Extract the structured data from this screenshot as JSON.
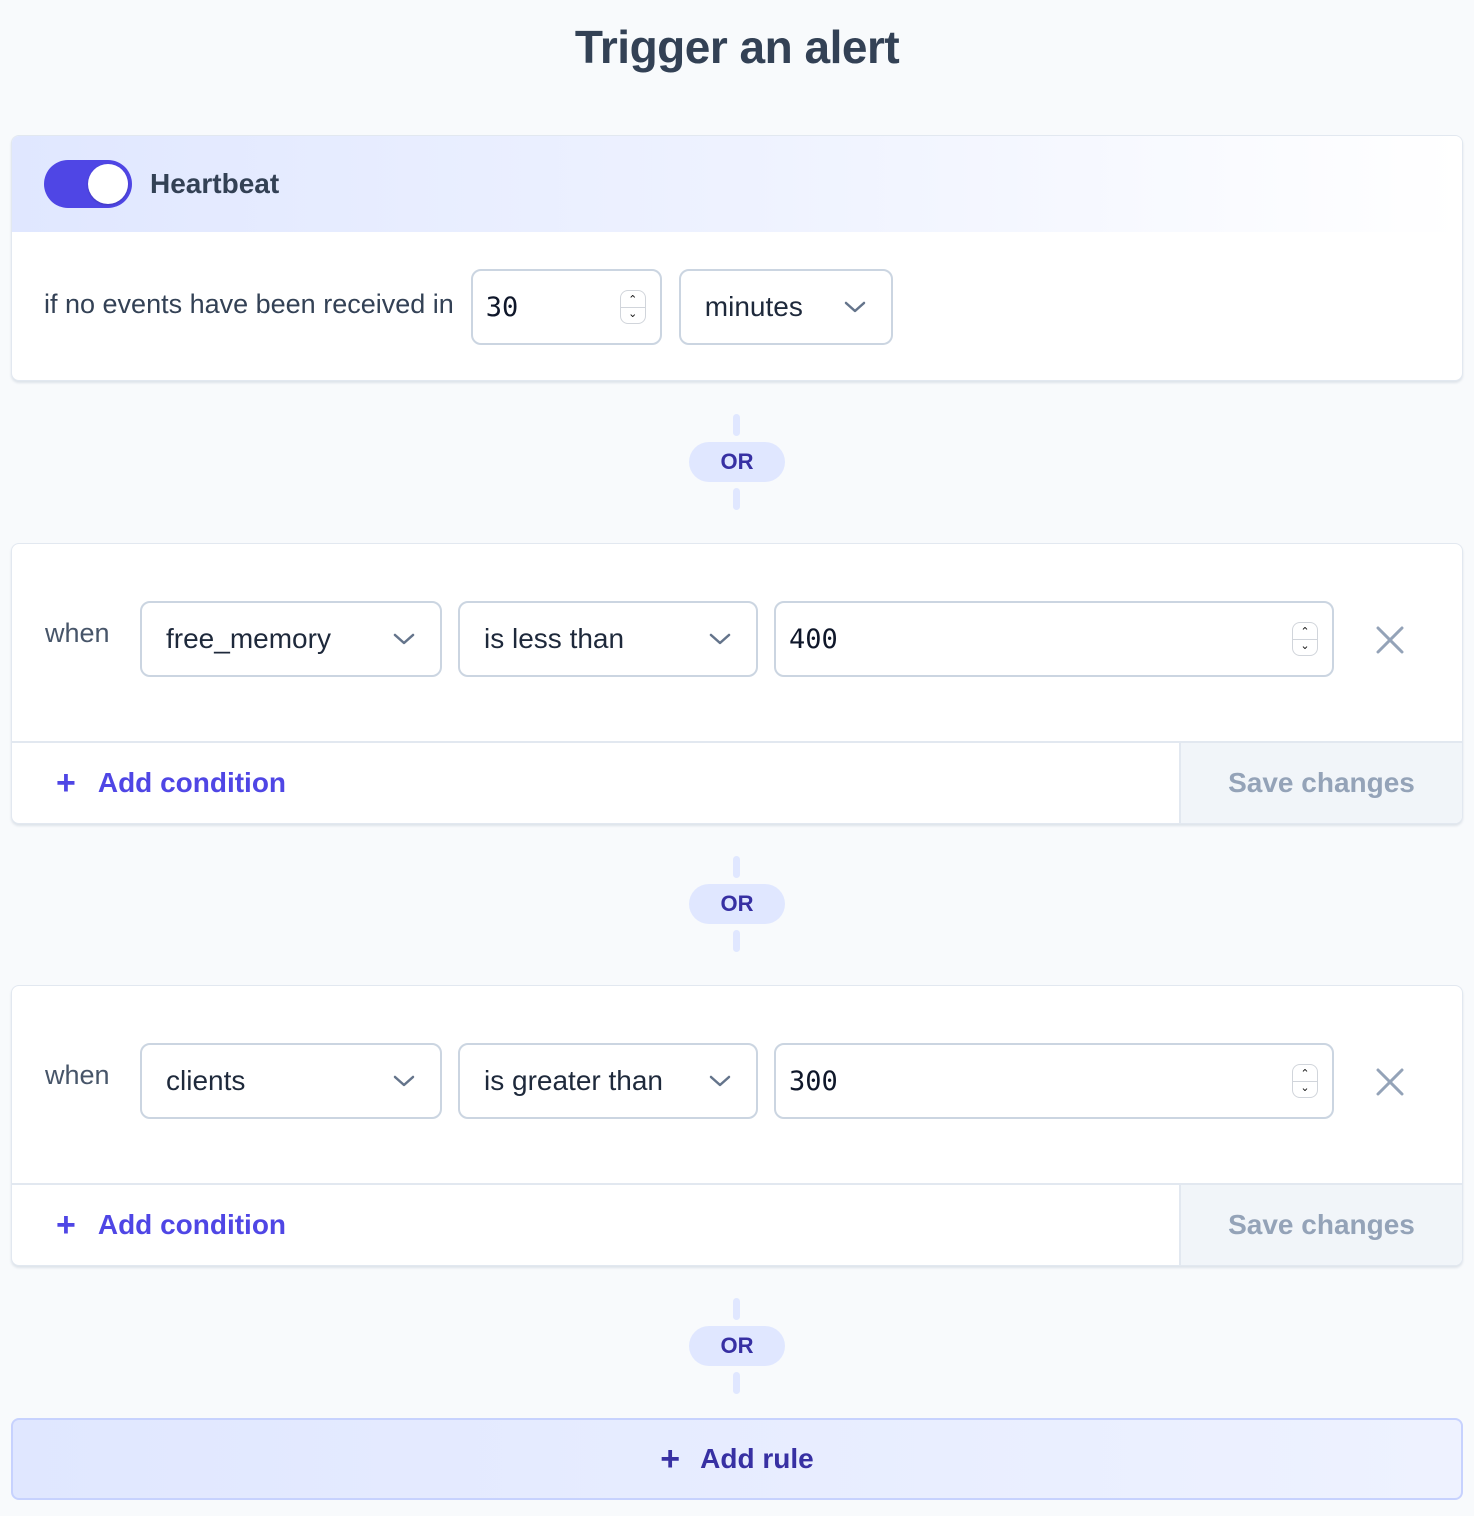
{
  "page": {
    "title": "Trigger an alert"
  },
  "heartbeat": {
    "enabled": true,
    "label": "Heartbeat",
    "description": "if no events have been received in",
    "interval_value": "30",
    "interval_unit": "minutes",
    "toggle_icon": "toggle-switch-on"
  },
  "separator": {
    "label": "OR"
  },
  "rules": [
    {
      "when_label": "when",
      "metric": "free_memory",
      "operator": "is less than",
      "value": "400",
      "add_condition_label": "Add condition",
      "save_label": "Save changes"
    },
    {
      "when_label": "when",
      "metric": "clients",
      "operator": "is greater than",
      "value": "300",
      "add_condition_label": "Add condition",
      "save_label": "Save changes"
    }
  ],
  "icons": {
    "plus": "+",
    "spinner_up": "⌃",
    "spinner_down": "⌄"
  },
  "add_rule": {
    "label": "Add rule"
  },
  "colors": {
    "accent": "#4f46e5",
    "accent_dark": "#3730a3",
    "accent_light": "#e0e7ff",
    "muted": "#94a3b8",
    "background": "#f8fafc"
  }
}
